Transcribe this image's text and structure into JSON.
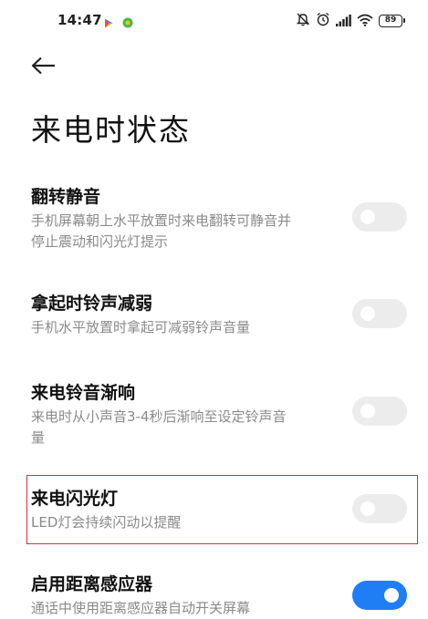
{
  "status_bar": {
    "time": "14:47",
    "battery_level": "89",
    "app_icons": [
      "play-store-icon",
      "green-app-icon"
    ],
    "right_icons": [
      "do-not-disturb-icon",
      "alarm-icon",
      "signal-icon",
      "wifi-icon",
      "battery-icon"
    ]
  },
  "page": {
    "title": "来电时状态"
  },
  "settings": [
    {
      "title": "翻转静音",
      "desc_lines": [
        "手机屏幕朝上水平放置时来电翻转可静音并",
        "停止震动和闪光灯提示"
      ],
      "enabled": false
    },
    {
      "title": "拿起时铃声减弱",
      "desc_lines": [
        "手机水平放置时拿起可减弱铃声音量"
      ],
      "enabled": false
    },
    {
      "title": "来电铃音渐响",
      "desc_lines": [
        "来电时从小声音3-4秒后渐响至设定铃声音",
        "量"
      ],
      "enabled": false
    },
    {
      "title": "来电闪光灯",
      "desc_lines": [
        "LED灯会持续闪动以提醒"
      ],
      "enabled": false,
      "highlighted": true
    },
    {
      "title": "启用距离感应器",
      "desc_lines": [
        "通话中使用距离感应器自动开关屏幕"
      ],
      "enabled": true
    }
  ],
  "colors": {
    "accent": "#1f7ef6",
    "toggle_off": "#ececec",
    "highlight_border": "#d93030",
    "desc_text": "#8a8a8a"
  }
}
